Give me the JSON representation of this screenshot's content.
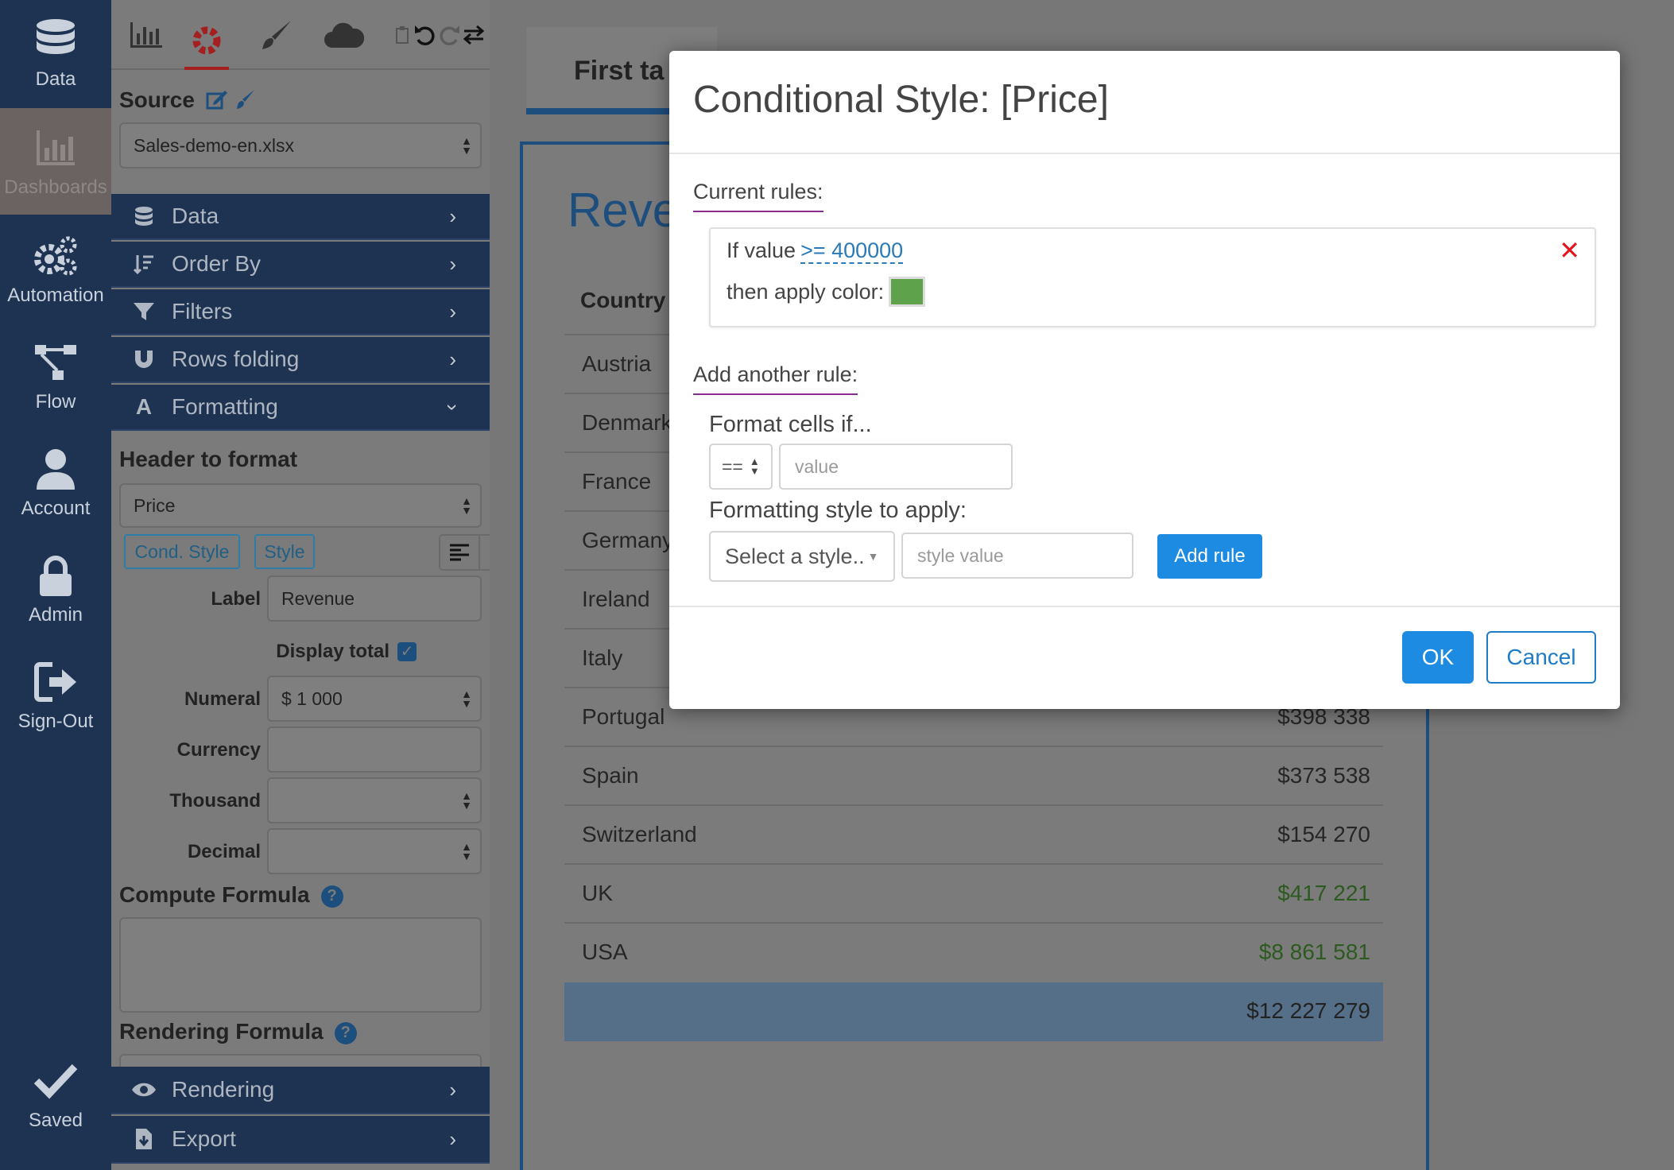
{
  "nav": {
    "items": [
      {
        "label": "Data",
        "icon": "database-icon"
      },
      {
        "label": "Dashboards",
        "icon": "bar-chart-icon"
      },
      {
        "label": "Automation",
        "icon": "gears-icon"
      },
      {
        "label": "Flow",
        "icon": "flow-icon"
      },
      {
        "label": "Account",
        "icon": "user-icon"
      },
      {
        "label": "Admin",
        "icon": "lock-icon"
      },
      {
        "label": "Sign-Out",
        "icon": "sign-out-icon"
      }
    ],
    "active": "Dashboards",
    "saved_label": "Saved"
  },
  "panel": {
    "source_label": "Source",
    "source_value": "Sales-demo-en.xlsx",
    "accordion": [
      {
        "label": "Data",
        "icon": "database-icon"
      },
      {
        "label": "Order By",
        "icon": "sort-icon"
      },
      {
        "label": "Filters",
        "icon": "filter-icon"
      },
      {
        "label": "Rows folding",
        "icon": "magnet-icon"
      },
      {
        "label": "Formatting",
        "icon": "font-icon"
      }
    ],
    "header_to_format_label": "Header to format",
    "header_value": "Price",
    "cond_style_label": "Cond. Style",
    "style_label": "Style",
    "label_label": "Label",
    "label_value": "Revenue",
    "display_total_label": "Display total",
    "display_total_checked": true,
    "numeral_label": "Numeral",
    "numeral_value": "$ 1 000",
    "currency_label": "Currency",
    "currency_value": "",
    "thousand_label": "Thousand",
    "thousand_value": "",
    "decimal_label": "Decimal",
    "decimal_value": "",
    "compute_formula_label": "Compute Formula",
    "rendering_formula_label": "Rendering Formula",
    "rendering_label": "Rendering",
    "export_label": "Export"
  },
  "dashboard": {
    "tab_label": "First ta",
    "widget_title": "Reve",
    "column_country": "Country",
    "rows": [
      {
        "country": "Austria",
        "value": ""
      },
      {
        "country": "Denmark",
        "value": ""
      },
      {
        "country": "France",
        "value": ""
      },
      {
        "country": "Germany",
        "value": ""
      },
      {
        "country": "Ireland",
        "value": ""
      },
      {
        "country": "Italy",
        "value": ""
      },
      {
        "country": "Portugal",
        "value": "$398 338"
      },
      {
        "country": "Spain",
        "value": "$373 538"
      },
      {
        "country": "Switzerland",
        "value": "$154 270"
      },
      {
        "country": "UK",
        "value": "$417 221",
        "highlight": true
      },
      {
        "country": "USA",
        "value": "$8 861 581",
        "highlight": true
      }
    ],
    "total": "$12 227 279"
  },
  "modal": {
    "title": "Conditional Style: [Price]",
    "current_rules_label": "Current rules:",
    "rule_if_prefix": "If value",
    "rule_condition": ">= 400000",
    "rule_then_prefix": "then apply color:",
    "rule_color": "#5ea34c",
    "add_rule_section_label": "Add another rule:",
    "format_cells_if_label": "Format cells if...",
    "operator_value": "==",
    "value_placeholder": "value",
    "formatting_style_label": "Formatting style to apply:",
    "style_select_value": "Select a style..",
    "style_value_placeholder": "style value",
    "add_rule_button": "Add rule",
    "ok_button": "OK",
    "cancel_button": "Cancel"
  },
  "colors": {
    "nav_bg": "#1e3352",
    "accent_blue": "#1e8be3",
    "delete_red": "#e4141c",
    "rule_color": "#5ea34c",
    "section_underline": "#8a2d8a"
  }
}
